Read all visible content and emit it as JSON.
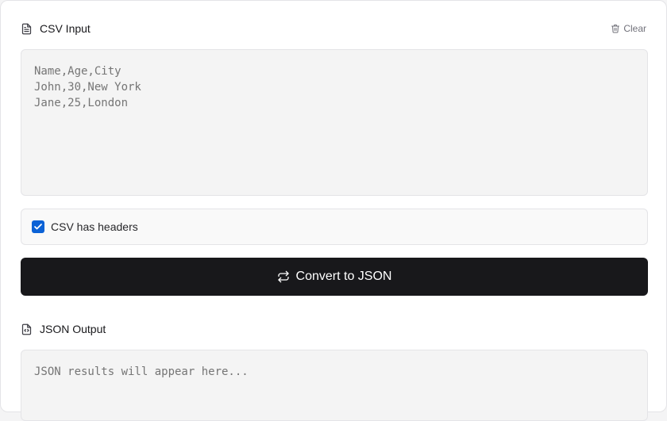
{
  "input_section": {
    "title": "CSV Input",
    "icon": "file-text-icon",
    "clear_label": "Clear",
    "clear_icon": "trash-icon",
    "textarea_placeholder": "Name,Age,City\nJohn,30,New York\nJane,25,London"
  },
  "headers_option": {
    "label": "CSV has headers",
    "checked": true
  },
  "convert_button": {
    "label": "Convert to JSON",
    "icon": "arrows-swap-icon"
  },
  "output_section": {
    "title": "JSON Output",
    "icon": "file-code-icon",
    "textarea_placeholder": "JSON results will appear here..."
  },
  "colors": {
    "primary_button": "#18181b",
    "checkbox": "#0b62d6",
    "muted_text": "#71717a"
  }
}
